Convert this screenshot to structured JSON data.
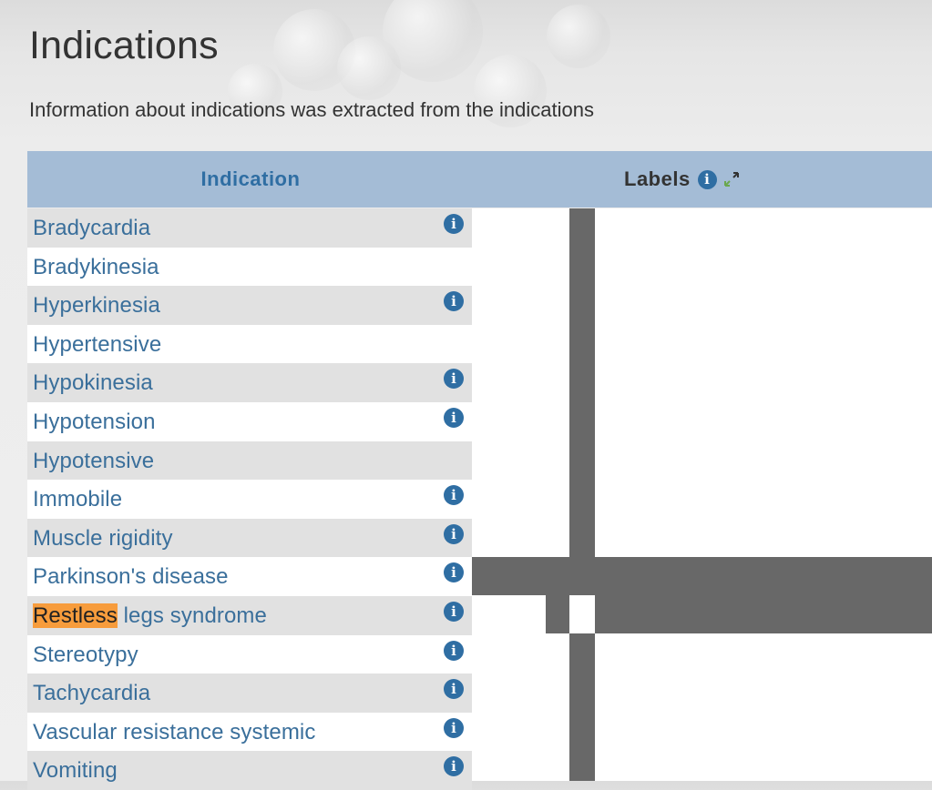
{
  "page": {
    "title": "Indications",
    "intro": "Information about indications was extracted from the indications"
  },
  "table": {
    "headers": {
      "indication": "Indication",
      "labels": "Labels"
    },
    "icons": {
      "header_info": "info-circle-icon",
      "header_expand": "expand-arrows-icon",
      "row_info": "info-circle-icon"
    },
    "colors": {
      "header_bg": "#a4bcd6",
      "link_text": "#3a6f9b",
      "highlight": "#f79c3c",
      "mark": "#686868",
      "info_icon": "#2f6ea3"
    },
    "rows": [
      {
        "label": "Bradycardia",
        "info": true
      },
      {
        "label": "Bradykinesia",
        "info": false
      },
      {
        "label": "Hyperkinesia",
        "info": true
      },
      {
        "label": "Hypertensive",
        "info": false
      },
      {
        "label": "Hypokinesia",
        "info": true
      },
      {
        "label": "Hypotension",
        "info": true
      },
      {
        "label": "Hypotensive",
        "info": false
      },
      {
        "label": "Immobile",
        "info": true
      },
      {
        "label": "Muscle rigidity",
        "info": true
      },
      {
        "label": "Parkinson's disease",
        "info": true
      },
      {
        "label_highlight": "Restless",
        "label_rest": " legs syndrome",
        "info": true
      },
      {
        "label": "Stereotypy",
        "info": true
      },
      {
        "label": "Tachycardia",
        "info": true
      },
      {
        "label": "Vascular resistance systemic",
        "info": true
      },
      {
        "label": "Vomiting",
        "info": true
      }
    ]
  }
}
